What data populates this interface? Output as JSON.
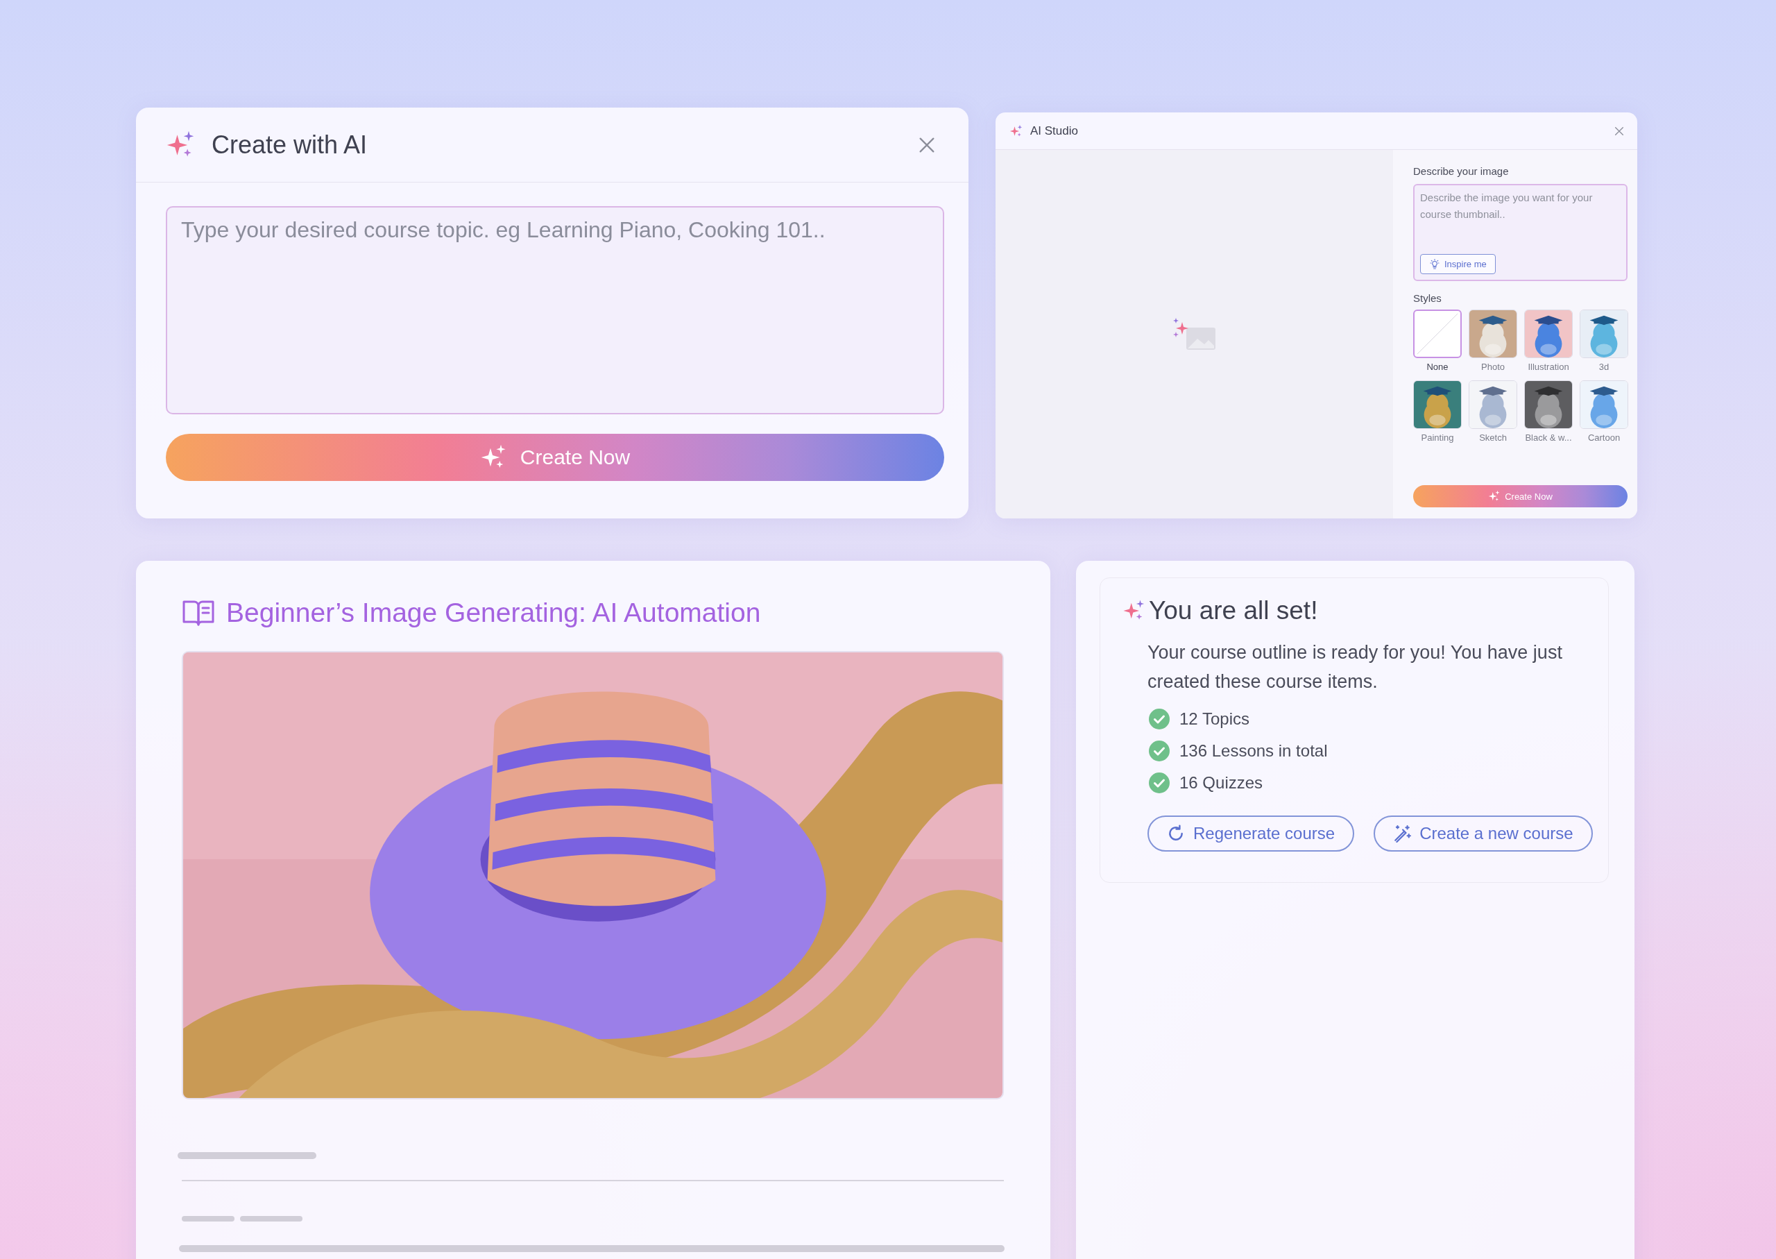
{
  "create_dialog": {
    "title": "Create with AI",
    "topic_field": {
      "placeholder": "Type your desired course topic. eg Learning Piano, Cooking 101.."
    },
    "create_button": "Create Now"
  },
  "ai_studio": {
    "title": "AI Studio",
    "describe_label": "Describe your image",
    "describe_field": {
      "placeholder": "Describe the image you want for your course thumbnail.."
    },
    "inspire_button": "Inspire me",
    "styles_label": "Styles",
    "styles": [
      {
        "label": "None",
        "selected": true,
        "kind": "none"
      },
      {
        "label": "Photo",
        "selected": false,
        "kind": "picture"
      },
      {
        "label": "Illustration",
        "selected": false,
        "kind": "picture"
      },
      {
        "label": "3d",
        "selected": false,
        "kind": "picture"
      },
      {
        "label": "Painting",
        "selected": false,
        "kind": "picture"
      },
      {
        "label": "Sketch",
        "selected": false,
        "kind": "picture"
      },
      {
        "label": "Black & w...",
        "selected": false,
        "kind": "picture"
      },
      {
        "label": "Cartoon",
        "selected": false,
        "kind": "picture"
      }
    ],
    "create_button": "Create Now"
  },
  "course": {
    "title": "Beginner’s Image Generating: AI Automation"
  },
  "summary": {
    "title": "You are all set!",
    "message": "Your course outline is ready for you! You have just created these course items.",
    "items": [
      {
        "label": "12 Topics",
        "done": true
      },
      {
        "label": "136 Lessons in total",
        "done": true
      },
      {
        "label": "16 Quizzes",
        "done": true
      }
    ],
    "buttons": [
      {
        "label": "Regenerate course",
        "kind": "regenerate"
      },
      {
        "label": "Create a new course",
        "kind": "create"
      }
    ]
  }
}
